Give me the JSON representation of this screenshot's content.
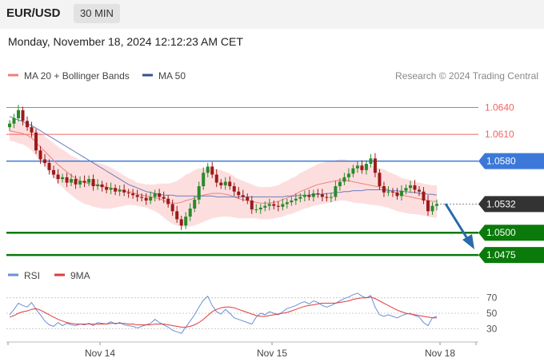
{
  "header": {
    "pair": "EUR/USD",
    "timeframe": "30 MIN"
  },
  "date_line": "Monday, November 18, 2024 12:12:23 AM CET",
  "legend": {
    "ma20": "MA 20 + Bollinger Bands",
    "ma50": "MA 50",
    "research": "Research © 2024 Trading Central",
    "rsi": "RSI",
    "rsi_ma": "9MA"
  },
  "colors": {
    "up": "#2a8a2a",
    "down": "#9b1b1b",
    "bollinger": "#fdd8d8",
    "ma20": "#f08080",
    "ma50": "#6a7dbd",
    "resistance": "#f06464",
    "pivot": "#3c78d8",
    "support": "#0a7a0a",
    "current": "#333333",
    "arrow": "#2a6aaa",
    "rsi": "#6b8fd6",
    "rsi_ma": "#e03c3c"
  },
  "chart_data": {
    "type": "candlestick",
    "x_labels": [
      "Nov 14",
      "Nov 15",
      "Nov 18"
    ],
    "y_range": [
      1.0468,
      1.0653
    ],
    "levels": [
      {
        "value": 1.064,
        "label": "1.0640",
        "kind": "resistance"
      },
      {
        "value": 1.061,
        "label": "1.0610",
        "kind": "resistance"
      },
      {
        "value": 1.058,
        "label": "1.0580",
        "kind": "pivot"
      },
      {
        "value": 1.0532,
        "label": "1.0532",
        "kind": "current"
      },
      {
        "value": 1.05,
        "label": "1.0500",
        "kind": "support"
      },
      {
        "value": 1.0475,
        "label": "1.0475",
        "kind": "support"
      }
    ],
    "closes": [
      1.0622,
      1.0628,
      1.0637,
      1.0625,
      1.0618,
      1.0612,
      1.0592,
      1.0582,
      1.0578,
      1.057,
      1.0565,
      1.056,
      1.0562,
      1.0556,
      1.056,
      1.0554,
      1.0558,
      1.0556,
      1.056,
      1.0552,
      1.0554,
      1.0551,
      1.0548,
      1.055,
      1.0546,
      1.0548,
      1.0545,
      1.0544,
      1.0542,
      1.054,
      1.0539,
      1.0536,
      1.054,
      1.0544,
      1.054,
      1.0538,
      1.0532,
      1.0524,
      1.0515,
      1.0508,
      1.0518,
      1.0527,
      1.0537,
      1.0552,
      1.0567,
      1.0574,
      1.0565,
      1.0556,
      1.0553,
      1.0557,
      1.0552,
      1.0546,
      1.0542,
      1.054,
      1.0536,
      1.0526,
      1.0526,
      1.0528,
      1.053,
      1.0532,
      1.053,
      1.0529,
      1.0532,
      1.0534,
      1.0536,
      1.0538,
      1.054,
      1.0542,
      1.054,
      1.0544,
      1.0543,
      1.054,
      1.0539,
      1.054,
      1.0552,
      1.0557,
      1.0562,
      1.0566,
      1.0572,
      1.0575,
      1.057,
      1.0577,
      1.0583,
      1.0567,
      1.0552,
      1.0545,
      1.0546,
      1.0545,
      1.0541,
      1.0547,
      1.055,
      1.0553,
      1.0548,
      1.0546,
      1.0536,
      1.0524,
      1.053,
      1.0532
    ],
    "ma20": [
      1.0614,
      1.0613,
      1.0612,
      1.0611,
      1.0609,
      1.0606,
      1.0601,
      1.0596,
      1.0591,
      1.0586,
      1.0581,
      1.0576,
      1.0572,
      1.0568,
      1.0564,
      1.0561,
      1.0558,
      1.0556,
      1.0555,
      1.0554,
      1.0553,
      1.0552,
      1.0551,
      1.055,
      1.0549,
      1.0548,
      1.0547,
      1.0546,
      1.0545,
      1.0543,
      1.0542,
      1.0541,
      1.054,
      1.0539,
      1.0538,
      1.0536,
      1.0534,
      1.0533,
      1.0533,
      1.0534,
      1.0536,
      1.0537,
      1.0539,
      1.0541,
      1.0542,
      1.0543,
      1.0544,
      1.0544,
      1.0544,
      1.0543,
      1.0542,
      1.054,
      1.0538,
      1.0537,
      1.0536,
      1.0535,
      1.0534,
      1.0533,
      1.0533,
      1.0533,
      1.0534,
      1.0535,
      1.0537,
      1.0539,
      1.0541,
      1.0543,
      1.0546,
      1.0548,
      1.055,
      1.0552,
      1.0554,
      1.0555,
      1.0556,
      1.0557,
      1.0558,
      1.0559,
      1.0559,
      1.0558,
      1.0557,
      1.0556,
      1.0555,
      1.0554,
      1.0553,
      1.0552,
      1.0551,
      1.055,
      1.0548,
      1.0546,
      1.0544,
      1.0542,
      1.0541,
      1.054,
      1.0539,
      1.0538,
      1.0537,
      1.0536,
      1.0535,
      1.0535
    ],
    "bb_width": [
      0.0011,
      0.0011,
      0.0012,
      0.0012,
      0.0013,
      0.0014,
      0.0015,
      0.0016,
      0.0017,
      0.0018,
      0.0019,
      0.002,
      0.0021,
      0.0022,
      0.0022,
      0.0023,
      0.0023,
      0.0024,
      0.0024,
      0.0025,
      0.0025,
      0.0025,
      0.0024,
      0.0023,
      0.0021,
      0.0019,
      0.0017,
      0.0015,
      0.0014,
      0.0013,
      0.0013,
      0.0013,
      0.0014,
      0.0015,
      0.0017,
      0.0019,
      0.0021,
      0.0023,
      0.0025,
      0.0027,
      0.0029,
      0.003,
      0.0031,
      0.0031,
      0.003,
      0.0029,
      0.0028,
      0.0027,
      0.0026,
      0.0025,
      0.0024,
      0.0023,
      0.0022,
      0.0021,
      0.002,
      0.0019,
      0.0018,
      0.0018,
      0.0018,
      0.0018,
      0.0018,
      0.0018,
      0.0019,
      0.0019,
      0.002,
      0.002,
      0.0021,
      0.0021,
      0.0022,
      0.0022,
      0.0023,
      0.0023,
      0.0023,
      0.0023,
      0.0023,
      0.0023,
      0.0023,
      0.0023,
      0.0023,
      0.0023,
      0.0022,
      0.0022,
      0.0022,
      0.0021,
      0.0021,
      0.0021,
      0.002,
      0.002,
      0.002,
      0.0019,
      0.0019,
      0.0019,
      0.0018,
      0.0018,
      0.0018,
      0.0018,
      0.0018,
      0.0018
    ],
    "ma50": [
      1.063,
      1.0628,
      1.0626,
      1.0624,
      1.0622,
      1.062,
      1.0617,
      1.0614,
      1.0611,
      1.0608,
      1.0605,
      1.0602,
      1.0599,
      1.0596,
      1.0593,
      1.059,
      1.0587,
      1.0584,
      1.0581,
      1.0578,
      1.0575,
      1.0572,
      1.0569,
      1.0566,
      1.0563,
      1.056,
      1.0557,
      1.0554,
      1.0552,
      1.055,
      1.0548,
      1.0546,
      1.0545,
      1.0544,
      1.0543,
      1.0542,
      1.0542,
      1.0542,
      1.0541,
      1.0541,
      1.0541,
      1.0541,
      1.0541,
      1.0541,
      1.0541,
      1.0541,
      1.0541,
      1.054,
      1.054,
      1.054,
      1.054,
      1.054,
      1.054,
      1.054,
      1.054,
      1.054,
      1.054,
      1.054,
      1.054,
      1.054,
      1.054,
      1.054,
      1.054,
      1.0541,
      1.0541,
      1.0541,
      1.0542,
      1.0542,
      1.0542,
      1.0543,
      1.0543,
      1.0543,
      1.0544,
      1.0544,
      1.0545,
      1.0545,
      1.0546,
      1.0546,
      1.0547,
      1.0547,
      1.0547,
      1.0548,
      1.0548,
      1.0548,
      1.0548,
      1.0548,
      1.0547,
      1.0547,
      1.0547,
      1.0546,
      1.0546,
      1.0545,
      1.0545,
      1.0544,
      1.0544,
      1.0543,
      1.0543,
      1.0542
    ],
    "rsi": {
      "y_range": [
        20,
        80
      ],
      "ticks": [
        70,
        50,
        30
      ],
      "values": [
        48,
        55,
        63,
        60,
        58,
        64,
        55,
        48,
        40,
        35,
        33,
        38,
        34,
        37,
        35,
        34,
        36,
        35,
        37,
        34,
        38,
        37,
        36,
        39,
        36,
        38,
        35,
        34,
        33,
        31,
        33,
        35,
        37,
        42,
        38,
        35,
        32,
        28,
        26,
        24,
        32,
        40,
        48,
        58,
        67,
        72,
        60,
        52,
        49,
        55,
        50,
        44,
        42,
        40,
        38,
        36,
        45,
        50,
        48,
        52,
        50,
        48,
        52,
        56,
        58,
        60,
        63,
        65,
        62,
        66,
        64,
        60,
        58,
        60,
        63,
        66,
        69,
        71,
        74,
        76,
        72,
        70,
        73,
        58,
        48,
        46,
        48,
        46,
        44,
        47,
        49,
        50,
        47,
        45,
        38,
        34,
        44,
        46
      ],
      "ma": [
        45,
        47,
        50,
        52,
        53,
        55,
        56,
        54,
        51,
        48,
        45,
        42,
        40,
        38,
        37,
        36,
        36,
        36,
        36,
        36,
        36,
        36,
        36,
        37,
        37,
        37,
        37,
        36,
        36,
        35,
        35,
        35,
        35,
        36,
        36,
        36,
        35,
        34,
        33,
        32,
        32,
        33,
        35,
        38,
        42,
        47,
        52,
        55,
        57,
        58,
        58,
        57,
        55,
        53,
        51,
        49,
        47,
        46,
        46,
        47,
        48,
        49,
        50,
        51,
        53,
        55,
        57,
        59,
        60,
        61,
        62,
        63,
        63,
        63,
        63,
        64,
        65,
        66,
        68,
        69,
        70,
        70,
        71,
        69,
        66,
        63,
        60,
        57,
        54,
        52,
        50,
        49,
        48,
        47,
        46,
        45,
        44,
        44
      ]
    }
  }
}
